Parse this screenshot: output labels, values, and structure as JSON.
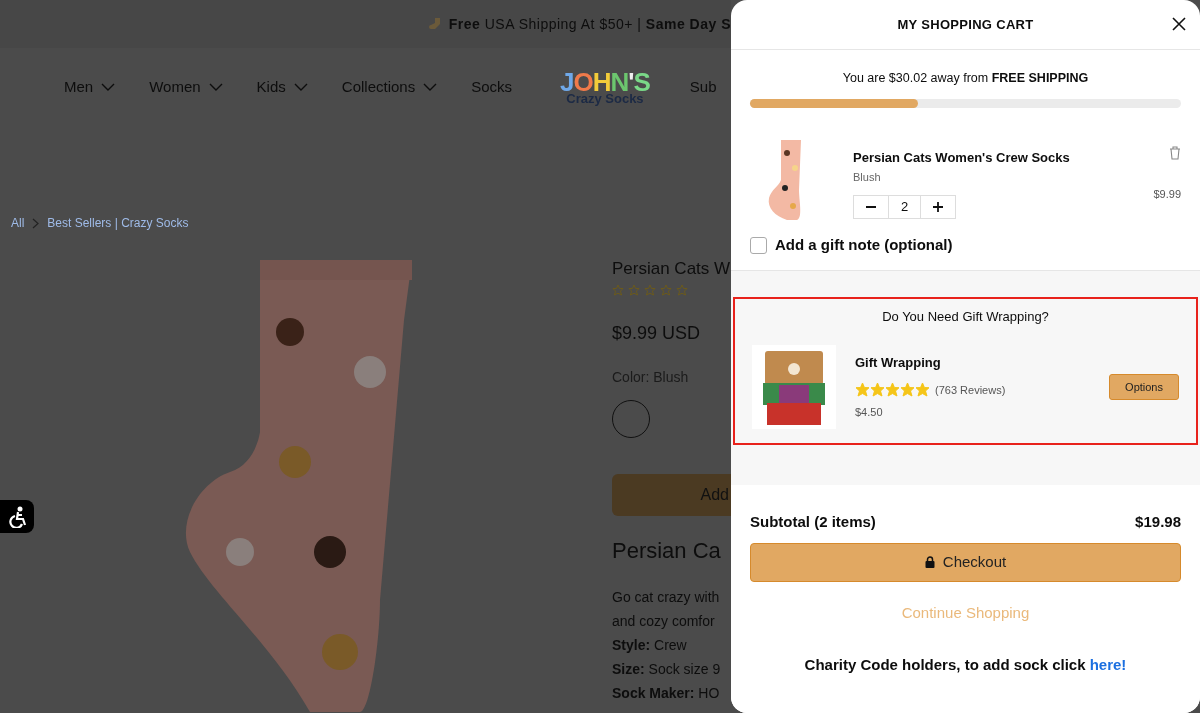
{
  "announcement": "**Free** USA Shipping At $50+ | **Same Day S**",
  "nav": {
    "items": [
      {
        "label": "Men",
        "dropdown": true
      },
      {
        "label": "Women",
        "dropdown": true
      },
      {
        "label": "Kids",
        "dropdown": true
      },
      {
        "label": "Collections",
        "dropdown": true
      },
      {
        "label": "Socks",
        "dropdown": false
      }
    ],
    "logo": {
      "line_1": "JOHN'S",
      "line_2": "Crazy Socks"
    },
    "cut_item": "Sub"
  },
  "breadcrumb": [
    "All",
    "Best Sellers | Crazy Socks"
  ],
  "product": {
    "title": "Persian Cats W",
    "stars": 0,
    "price": "$9.99 USD",
    "color_label": "Color: Blush",
    "add_button": "Add",
    "heading": "Persian Ca",
    "description": [
      "Go cat crazy with",
      "and cozy comfor"
    ],
    "specs": [
      {
        "label": "Style:",
        "value": "Crew"
      },
      {
        "label": "Size:",
        "value": "Sock size 9"
      },
      {
        "label": "Sock Maker:",
        "value": "HO"
      }
    ]
  },
  "cart": {
    "title": "MY SHOPPING CART",
    "shipping_message": "You are $30.02 away from **FREE SHIPPING**",
    "shipping_progress": {
      "level": 0.39
    },
    "items": [
      {
        "name": "Persian Cats Women's Crew Socks",
        "variant": "Blush",
        "quantity": "2",
        "price": "$9.99"
      }
    ],
    "gift_note": {
      "label": "Add a gift note (optional)",
      "checked": false
    },
    "upsell": {
      "title": "Do You Need Gift Wrapping?",
      "highlighted": true,
      "name": "Gift Wrapping",
      "stars": 5,
      "reviews": "(763 Reviews)",
      "price": "$4.50",
      "button": "Options"
    },
    "subtotal_label": "Subtotal (2 items)",
    "subtotal": "$19.98",
    "checkout": "Checkout",
    "continue": "Continue Shopping",
    "charity": {
      "text": "Charity Code holders, to add sock click",
      "link": "here!"
    }
  }
}
